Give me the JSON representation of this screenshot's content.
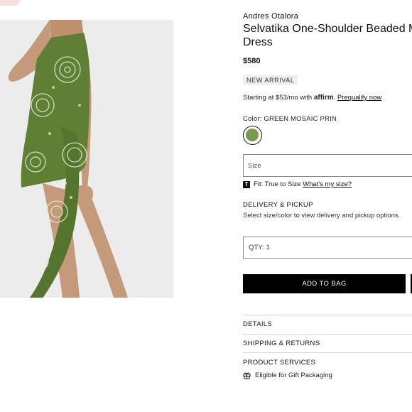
{
  "product": {
    "brand": "Andres Otalora",
    "title": "Selvatika One-Shoulder Beaded Mini Dress",
    "price": "$580",
    "badge": "NEW ARRIVAL",
    "image_alt": "Model wearing green mosaic print one-shoulder dress"
  },
  "financing": {
    "prefix": "Starting at $53/mo with",
    "provider": "affirm",
    "suffix": ".",
    "link": "Prequalify now"
  },
  "color": {
    "label": "Color:",
    "value": "GREEN MOSAIC PRIN",
    "swatch_hex": "#7a9b4e"
  },
  "size": {
    "placeholder": "Size"
  },
  "fit": {
    "icon": "T",
    "text": "Fit: True to Size",
    "link": "What's my size?"
  },
  "delivery": {
    "heading": "DELIVERY & PICKUP",
    "text": "Select size/color to view delivery and pickup options."
  },
  "quantity": {
    "label": "QTY:",
    "value": "1"
  },
  "actions": {
    "add_to_bag": "ADD TO BAG"
  },
  "accordion": {
    "details": "DETAILS",
    "shipping": "SHIPPING & RETURNS",
    "services": "PRODUCT SERVICES"
  },
  "services": {
    "gift": "Eligible for Gift Packaging"
  }
}
